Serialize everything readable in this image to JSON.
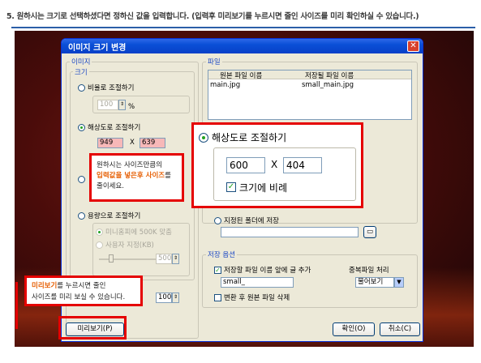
{
  "caption": "5. 원하시는 크기로 선택하셨다면 정하신 값을 입력합니다. (입력후 미리보기를 누르시면 줄인 사이즈를 미리 확인하실 수 있습니다.)",
  "dialog": {
    "title": "이미지 크기 변경",
    "image_group": {
      "label": "이미지",
      "size_group": {
        "label": "크기",
        "ratio_option": "비율로 조절하기",
        "ratio_value": "100",
        "ratio_unit": "%",
        "resolution_option": "해상도로 조절하기",
        "width": "949",
        "height": "639",
        "times": "X",
        "capacity_option": "용량으로 조절하기",
        "mini_homepage_option": "미니홈피에 500K 맞춤",
        "user_spec_option": "사용자 지정(KB)",
        "slider_value": "500",
        "quality_value": "100"
      }
    },
    "file_group": {
      "label": "파일",
      "columns": [
        "원본 파일 이름",
        "저장될 파일 이름"
      ],
      "rows": [
        [
          "main.jpg",
          "small_main.jpg"
        ]
      ]
    },
    "folder_option": "지정된 폴더에 저장",
    "save_options": {
      "label": "저장 옵션",
      "prefix_check": "저장할 파일 이름 앞에 글 추가",
      "prefix_value": "small_",
      "duplicate_label": "중복파일 처리",
      "duplicate_value": "물어보기",
      "delete_original": "변환 후 원본 파일 삭제"
    },
    "buttons": {
      "preview": "미리보기(P)",
      "ok": "확인(O)",
      "cancel": "취소(C)"
    }
  },
  "zoom_callout": {
    "option": "해상도로 조절하기",
    "width": "600",
    "height": "404",
    "times": "X",
    "keep_ratio": "크기에 비례"
  },
  "tip_callout": {
    "line1": "원하시는 사이즈만큼의",
    "line2_highlight": "입력값을 넣은후 사이즈",
    "line2_tail": "를",
    "line3": "줄이세요."
  },
  "preview_callout": {
    "highlight": "미리보기",
    "line1_tail": "를 누르시면 줄인",
    "line2": "사이즈를 미리 보실 수 있습니다."
  },
  "colors": {
    "callout_border": "#e50000",
    "highlight": "#e65d00",
    "title_bar": "#0a4fd6"
  }
}
